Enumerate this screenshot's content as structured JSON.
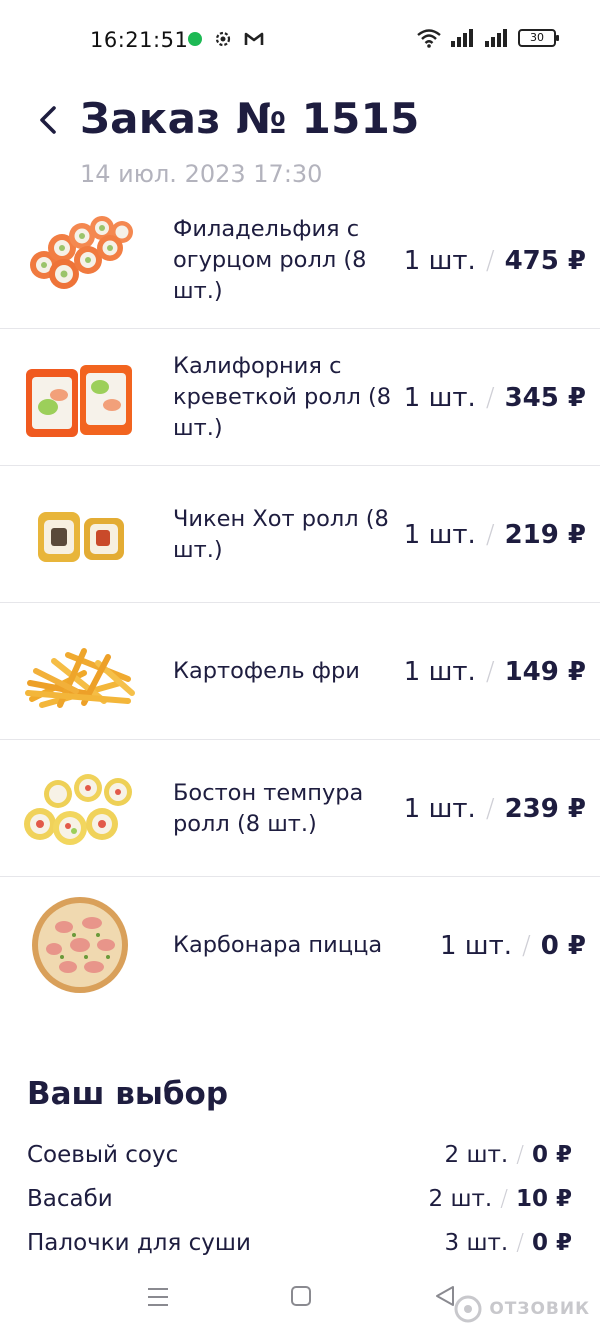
{
  "status_bar": {
    "time": "16:21:51",
    "icons": [
      "spotify-icon",
      "settings-gear-icon",
      "gmail-icon"
    ],
    "right_icons": [
      "wifi-icon",
      "signal-icon",
      "signal-icon"
    ],
    "battery": "30"
  },
  "header": {
    "title": "Заказ № 1515",
    "date": "14 июл. 2023 17:30"
  },
  "items": [
    {
      "name": "Филадельфия с огурцом ролл (8 шт.)",
      "qty": "1 шт.",
      "price": "475 ₽",
      "image": "philadelphia-roll"
    },
    {
      "name": "Калифорния с креветкой ролл (8 шт.)",
      "qty": "1 шт.",
      "price": "345 ₽",
      "image": "california-roll"
    },
    {
      "name": "Чикен Хот ролл (8 шт.)",
      "qty": "1 шт.",
      "price": "219 ₽",
      "image": "chicken-hot-roll"
    },
    {
      "name": "Картофель фри",
      "qty": "1 шт.",
      "price": "149 ₽",
      "image": "french-fries"
    },
    {
      "name": "Бостон темпура ролл (8 шт.)",
      "qty": "1 шт.",
      "price": "239 ₽",
      "image": "boston-tempura-roll"
    },
    {
      "name": "Карбонара пицца",
      "qty": "1 шт.",
      "price": "0 ₽",
      "image": "carbonara-pizza"
    }
  ],
  "extras": {
    "title": "Ваш выбор",
    "rows": [
      {
        "name": "Соевый соус",
        "qty": "2 шт.",
        "price": "0 ₽"
      },
      {
        "name": "Васаби",
        "qty": "2 шт.",
        "price": "10 ₽"
      },
      {
        "name": "Палочки для суши",
        "qty": "3 шт.",
        "price": "0 ₽"
      }
    ]
  },
  "separator": "/",
  "watermark": "ОТЗОВИК",
  "colors": {
    "text_dark": "#1e1d3f",
    "text_muted": "#b3b3bd",
    "divider": "#e6e6ea"
  }
}
